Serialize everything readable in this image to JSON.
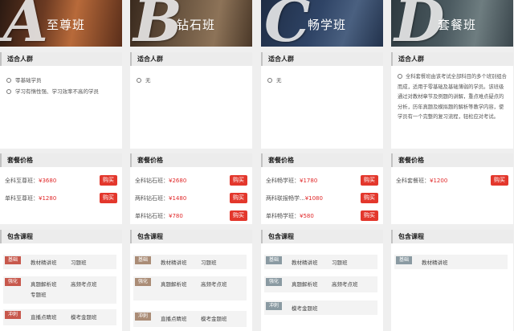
{
  "colors": {
    "accent_red": "#e3372c",
    "price_red": "#e0292a",
    "tag_red": "#c7584c",
    "tag_brown": "#aa8c76",
    "tag_gray": "#8a9aa2"
  },
  "plans": [
    {
      "letter": "A",
      "title": "至尊班",
      "audience_heading": "适合人群",
      "audience": [
        "零基础学员",
        "学习有惰性强、学习效率不高的学员"
      ],
      "price_heading": "套餐价格",
      "prices": [
        {
          "label": "全科至尊班：",
          "price": "¥3680",
          "buy": "购买"
        },
        {
          "label": "单科至尊班：",
          "price": "¥1280",
          "buy": "购买"
        }
      ],
      "courses_heading": "包含课程",
      "courses": [
        {
          "tag": "基础",
          "names": [
            "教材精讲班",
            "习题班"
          ]
        },
        {
          "tag": "强化",
          "names": [
            "真题解析班",
            "高频考点班",
            "专题班"
          ]
        },
        {
          "tag": "冲刺",
          "names": [
            "直播点睛班",
            "模考金题班"
          ]
        }
      ]
    },
    {
      "letter": "B",
      "title": "钻石班",
      "audience_heading": "适合人群",
      "audience": [
        "无"
      ],
      "price_heading": "套餐价格",
      "prices": [
        {
          "label": "全科钻石班：",
          "price": "¥2680",
          "buy": "购买"
        },
        {
          "label": "两科钻石班：",
          "price": "¥1480",
          "buy": "购买"
        },
        {
          "label": "单科钻石班：",
          "price": "¥780",
          "buy": "购买"
        }
      ],
      "courses_heading": "包含课程",
      "courses": [
        {
          "tag": "基础",
          "names": [
            "教材精讲班",
            "习题班"
          ]
        },
        {
          "tag": "强化",
          "names": [
            "真题解析班",
            "高频考点班"
          ]
        },
        {
          "tag": "冲刺",
          "names": [
            "直播点睛班",
            "模考金题班"
          ]
        }
      ]
    },
    {
      "letter": "C",
      "title": "畅学班",
      "audience_heading": "适合人群",
      "audience": [
        "无"
      ],
      "price_heading": "套餐价格",
      "prices": [
        {
          "label": "全科畅学班：",
          "price": "¥1780",
          "buy": "购买"
        },
        {
          "label": "两科联报畅学...",
          "price": "¥1080",
          "buy": "购买"
        },
        {
          "label": "单科畅学班：",
          "price": "¥580",
          "buy": "购买"
        }
      ],
      "courses_heading": "包含课程",
      "courses": [
        {
          "tag": "基础",
          "names": [
            "教材精讲班",
            "习题班"
          ]
        },
        {
          "tag": "强化",
          "names": [
            "真题解析班",
            "高频考点班"
          ]
        },
        {
          "tag": "冲刺",
          "names": [
            "模考金题班"
          ]
        }
      ]
    },
    {
      "letter": "D",
      "title": "套餐班",
      "audience_heading": "适合人群",
      "audience": [
        "全科套餐班由该考试全部科目的多个班别组合而成，适用于零基础及基础薄弱的学员。该班级通过对教材章节及例题的讲解，重点难点疑点的分析，历年真题及模拟题的解析等教学内容，使学员有一个完整的复习流程，轻松应对考试。"
      ],
      "price_heading": "套餐价格",
      "prices": [
        {
          "label": "全科套餐班：",
          "price": "¥1200",
          "buy": "购买"
        }
      ],
      "courses_heading": "包含课程",
      "courses": [
        {
          "tag": "基础",
          "names": [
            "教材精讲班"
          ]
        }
      ]
    }
  ]
}
